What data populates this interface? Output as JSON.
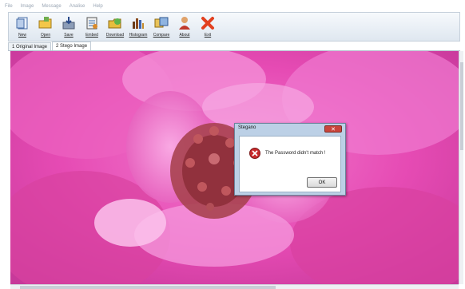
{
  "menu": [
    "File",
    "Image",
    "Message",
    "Analise",
    "Help"
  ],
  "toolbar": [
    {
      "label": "New",
      "icon": "new-document-icon"
    },
    {
      "label": "Open",
      "icon": "open-folder-icon"
    },
    {
      "label": "Save",
      "icon": "save-icon"
    },
    {
      "label": "Embed",
      "icon": "embed-icon"
    },
    {
      "label": "Download",
      "icon": "download-icon"
    },
    {
      "label": "Histogram",
      "icon": "histogram-icon"
    },
    {
      "label": "Compare",
      "icon": "compare-icon"
    },
    {
      "label": "About",
      "icon": "about-icon"
    },
    {
      "label": "Exit",
      "icon": "exit-icon"
    }
  ],
  "tabs": [
    {
      "label": "1 Original Image",
      "active": false
    },
    {
      "label": "2 Stego Image",
      "active": true
    }
  ],
  "dialog": {
    "title": "Stegano",
    "message": "The Password didn't match !",
    "ok_label": "OK",
    "close_glyph": "✕",
    "icon": "error-icon"
  },
  "colors": {
    "flower_pink": "#e64bb4",
    "flower_center": "#9c3a3e",
    "error_red": "#c8292b"
  }
}
